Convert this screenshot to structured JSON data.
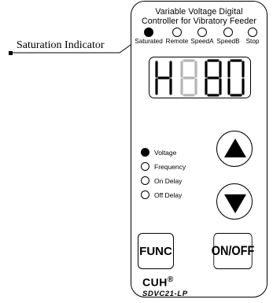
{
  "callout": {
    "label": "Saturation Indicator"
  },
  "panel": {
    "title_line1": "Variable Voltage Digital",
    "title_line2": "Controller for Vibratory Feeder",
    "indicators": [
      {
        "label": "Saturated",
        "active": true
      },
      {
        "label": "Remote",
        "active": false
      },
      {
        "label": "SpeedA",
        "active": false
      },
      {
        "label": "SpeedB",
        "active": false
      },
      {
        "label": "Stop",
        "active": false
      }
    ],
    "display": {
      "text": "H80",
      "lit_digits": [
        "H",
        "8",
        "0"
      ],
      "dim_digit": "8"
    },
    "modes": [
      {
        "label": "Voltage",
        "active": true
      },
      {
        "label": "Frequency",
        "active": false
      },
      {
        "label": "On Delay",
        "active": false
      },
      {
        "label": "Off Delay",
        "active": false
      }
    ],
    "buttons": {
      "func": "FUNC",
      "onoff": "ON/OFF"
    },
    "brand": "CUH",
    "brand_mark": "®",
    "model": "SDVC21-LP"
  }
}
